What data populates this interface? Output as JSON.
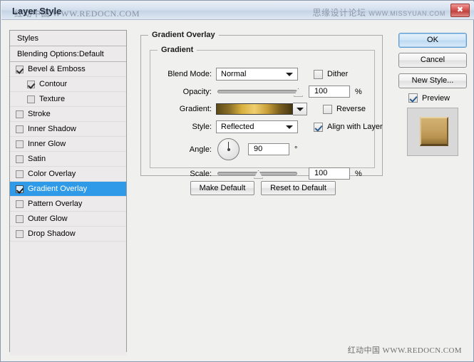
{
  "window": {
    "title": "Layer Style",
    "close_icon": "close-icon",
    "watermark_title": "红动中国 WWW.REDOCN.COM",
    "watermark_right_cn": "思缘设计论坛",
    "watermark_right_en": "WWW.MISSYUAN.COM",
    "watermark_bottom": "红动中国  WWW.REDOCN.COM"
  },
  "styles_panel": {
    "header": "Styles",
    "blending_options": "Blending Options:Default",
    "items": [
      {
        "label": "Bevel & Emboss",
        "checked": true,
        "indent": false,
        "selected": false
      },
      {
        "label": "Contour",
        "checked": true,
        "indent": true,
        "selected": false
      },
      {
        "label": "Texture",
        "checked": false,
        "indent": true,
        "selected": false
      },
      {
        "label": "Stroke",
        "checked": false,
        "indent": false,
        "selected": false
      },
      {
        "label": "Inner Shadow",
        "checked": false,
        "indent": false,
        "selected": false
      },
      {
        "label": "Inner Glow",
        "checked": false,
        "indent": false,
        "selected": false
      },
      {
        "label": "Satin",
        "checked": false,
        "indent": false,
        "selected": false
      },
      {
        "label": "Color Overlay",
        "checked": false,
        "indent": false,
        "selected": false
      },
      {
        "label": "Gradient Overlay",
        "checked": true,
        "indent": false,
        "selected": true
      },
      {
        "label": "Pattern Overlay",
        "checked": false,
        "indent": false,
        "selected": false
      },
      {
        "label": "Outer Glow",
        "checked": false,
        "indent": false,
        "selected": false
      },
      {
        "label": "Drop Shadow",
        "checked": false,
        "indent": false,
        "selected": false
      }
    ],
    "selection_color": "#2f9ae8"
  },
  "gradient_overlay": {
    "section_title": "Gradient Overlay",
    "group_title": "Gradient",
    "blend_mode": {
      "label": "Blend Mode:",
      "value": "Normal"
    },
    "dither": {
      "label": "Dither",
      "checked": false
    },
    "opacity": {
      "label": "Opacity:",
      "value": "100",
      "unit": "%",
      "slider_percent": 100
    },
    "gradient": {
      "label": "Gradient:",
      "stops": [
        "#5c4a16",
        "#8a6f28",
        "#d9b13f",
        "#f0cf70",
        "#caa139",
        "#7a5f1f",
        "#463612"
      ]
    },
    "reverse": {
      "label": "Reverse",
      "checked": false
    },
    "style": {
      "label": "Style:",
      "value": "Reflected"
    },
    "align_with_layer": {
      "label": "Align with Layer",
      "checked": true
    },
    "angle": {
      "label": "Angle:",
      "value": "90",
      "unit": "°",
      "degrees": 90
    },
    "scale": {
      "label": "Scale:",
      "value": "100",
      "unit": "%",
      "slider_percent": 50
    },
    "make_default": "Make Default",
    "reset_to_default": "Reset to Default"
  },
  "actions": {
    "ok": "OK",
    "cancel": "Cancel",
    "new_style": "New Style...",
    "preview": {
      "label": "Preview",
      "checked": true
    }
  }
}
